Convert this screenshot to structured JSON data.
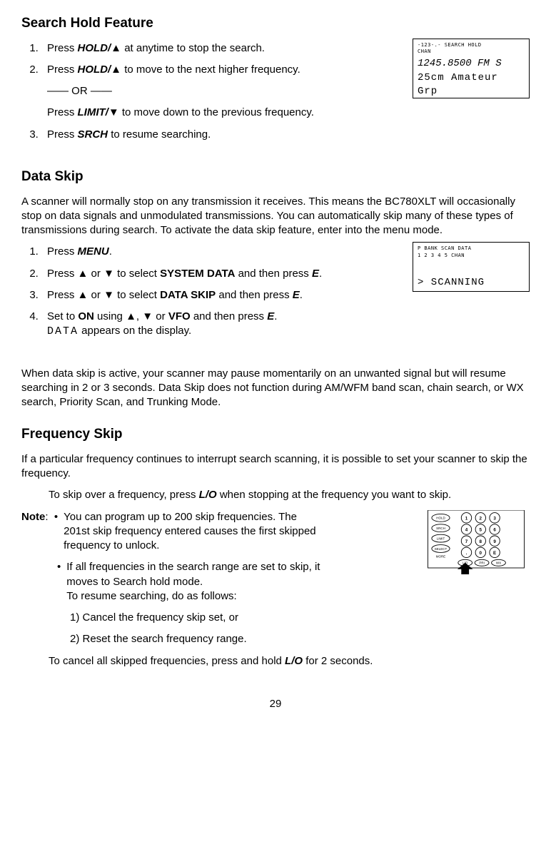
{
  "section1": {
    "heading": "Search Hold Feature",
    "steps": [
      {
        "pre": "Press ",
        "key": "HOLD/▲",
        "post": " at anytime to stop the search."
      },
      {
        "pre": "Press ",
        "key": "HOLD/▲",
        "post": " to move to the next higher frequency."
      },
      {
        "pre": "Press ",
        "key": "SRCH",
        "post": " to resume searching."
      }
    ],
    "or_label": "—— OR ——",
    "or_line": {
      "pre": "Press ",
      "key": "LIMIT/▼",
      "post": " to move down to the previous frequency."
    }
  },
  "fig1": {
    "top": "-123-.-       SEARCH  HOLD",
    "top2": "                       CHAN",
    "freq": "1245.8500   FM            S",
    "label": "25cm Amateur Grp"
  },
  "section2": {
    "heading": "Data Skip",
    "intro": "A scanner will normally stop on any transmission it receives. This means the BC780XLT will occasionally stop on data signals and unmodulated transmissions. You can automatically skip many of these types of transmissions during search. To activate the data skip feature, enter into the menu mode.",
    "step1": {
      "pre": "Press ",
      "key": "MENU",
      "post": "."
    },
    "step2": {
      "p1": "Press ",
      "t1": "▲",
      "p2": " or ",
      "t2": "▼",
      "p3": " to select ",
      "b": "SYSTEM DATA",
      "p4": " and then press ",
      "e": "E",
      "p5": "."
    },
    "step3": {
      "p1": "Press ",
      "t1": "▲",
      "p2": " or ",
      "t2": "▼",
      "p3": " to select ",
      "b": "DATA SKIP",
      "p4": " and then press ",
      "e": "E",
      "p5": "."
    },
    "step4": {
      "p1": "Set to ",
      "on": "ON",
      "p2": " using ",
      "t1": "▲",
      "p3": ", ",
      "t2": "▼",
      "p4": " or ",
      "vfo": "VFO",
      "p5": " and then press ",
      "e": "E",
      "p6": "."
    },
    "step4b": {
      "lcd": "DATA",
      "post": " appears on the display."
    },
    "para2": "When data skip is active, your scanner may pause momentarily on an unwanted signal but will resume searching in 2 or 3 seconds. Data Skip does not function during AM/WFM band scan, chain search, or WX search, Priority Scan, and Trunking Mode."
  },
  "fig2": {
    "top": "P    BANK      SCAN              DATA",
    "top2": "     1 2 3 4 5        CHAN",
    "text": "> SCANNING"
  },
  "section3": {
    "heading": "Frequency Skip",
    "intro": "If a particular frequency continues to interrupt search scanning, it is possible to set your scanner to skip the frequency.",
    "skip_line": {
      "p1": "To skip over a frequency, press ",
      "key": "L/O",
      "p2": " when stopping at the frequency you want to skip."
    },
    "note_label": "Note",
    "bullet1": "You can program up to 200 skip frequencies. The 201st skip frequency entered causes the first skipped frequency to unlock.",
    "bullet2a": "If all frequencies in the search range are set to skip, it moves to Search hold mode.",
    "bullet2b": "To resume searching, do as follows:",
    "sub1": "1) Cancel the frequency skip set, or",
    "sub2": "2) Reset the search frequency range.",
    "cancel": {
      "p1": "To cancel all skipped frequencies, press and hold ",
      "key": "L/O",
      "p2": " for 2 seconds."
    }
  },
  "keypad": {
    "left": [
      "HOLD",
      "SRCH",
      "LIMIT",
      "SELECT",
      "MORE"
    ],
    "nums": [
      [
        "1",
        "2",
        "3"
      ],
      [
        "4",
        "5",
        "6"
      ],
      [
        "7",
        "8",
        "9"
      ],
      [
        ".",
        "0",
        "E"
      ]
    ],
    "bottom": [
      "L/O",
      "PRI",
      "WX"
    ]
  },
  "page": "29"
}
